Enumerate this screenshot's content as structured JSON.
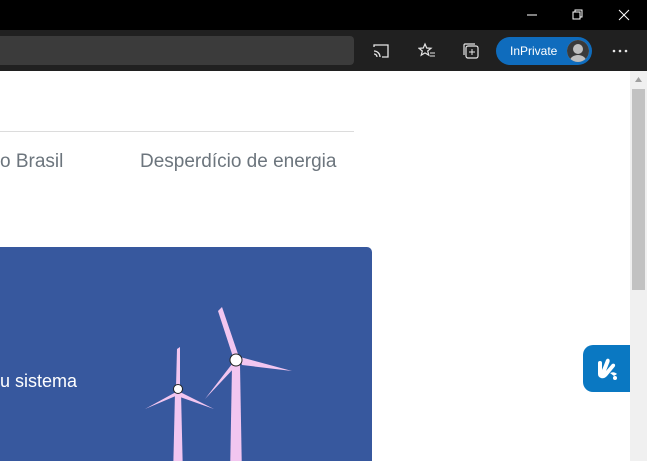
{
  "browser": {
    "inprivate_label": "InPrivate",
    "toolbar_icons": [
      "zoom-in-icon",
      "favorite-star-icon",
      "cast-icon",
      "favorites-list-icon",
      "collections-icon",
      "more-icon"
    ]
  },
  "page": {
    "nav_items": [
      "o Brasil",
      "Desperdício de energia"
    ],
    "banner_text": "u sistema"
  },
  "colors": {
    "titlebar": "#000000",
    "toolbar": "#202020",
    "inprivate": "#0f6cbd",
    "banner": "#37589e",
    "turbine": "#f2c6f0",
    "libras_widget": "#0a78c2"
  }
}
